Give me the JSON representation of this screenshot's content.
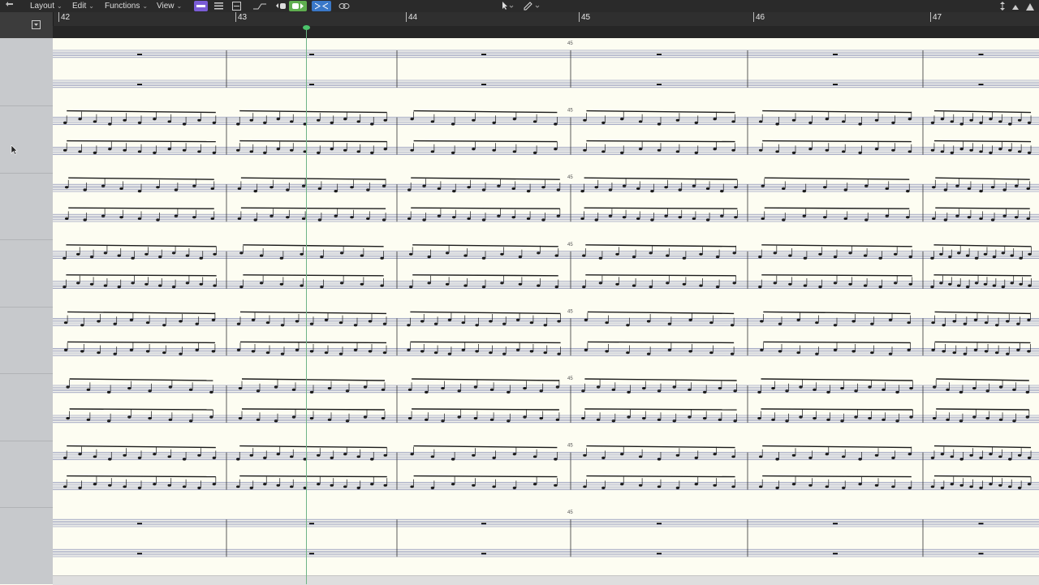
{
  "toolbar": {
    "menus": [
      {
        "label": "Layout"
      },
      {
        "label": "Edit"
      },
      {
        "label": "Functions"
      },
      {
        "label": "View"
      }
    ]
  },
  "ruler": {
    "bars": [
      "42",
      "43",
      "44",
      "45",
      "46",
      "47"
    ]
  },
  "score": {
    "systems": 8,
    "bar_marker": "45"
  },
  "colors": {
    "toolbar_bg": "#2a2a2a",
    "paper": "#fdfdf2",
    "staff_line": "#6a72a6",
    "note": "#1a1a1a",
    "playhead": "#4cc46c",
    "sidebar": "#c7c9cc",
    "accent_purple": "#7a5cd6",
    "accent_blue": "#3a78c8",
    "accent_green": "#5fae4f"
  },
  "icons": {
    "back": "back-arrow-icon",
    "pointer": "pointer-tool-icon",
    "pencil": "pencil-tool-icon",
    "link": "link-icon",
    "collapse": "collapse-icon"
  }
}
